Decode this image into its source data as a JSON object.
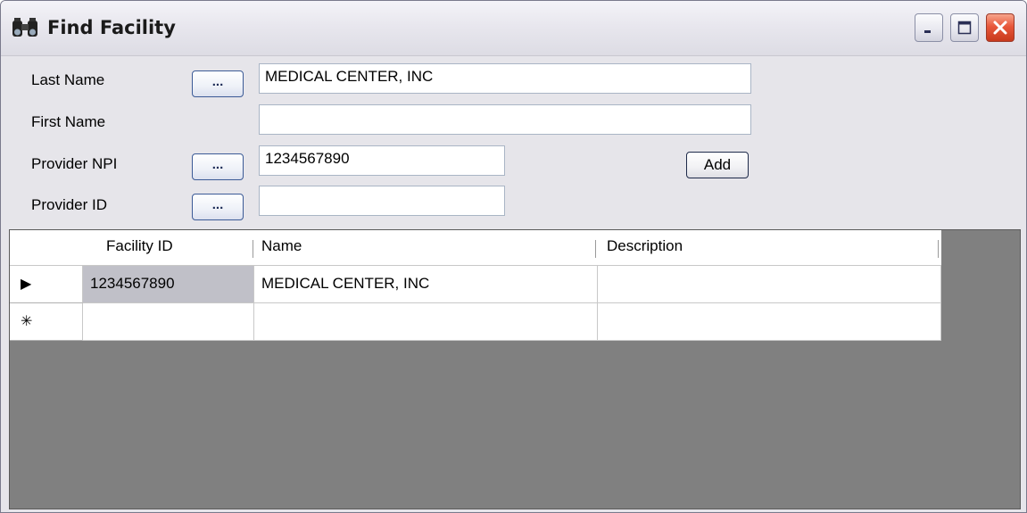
{
  "window": {
    "title": "Find Facility",
    "icon": "binoculars-icon",
    "controls": [
      "minimize-icon",
      "maximize-icon",
      "close-icon"
    ]
  },
  "form": {
    "last_name": {
      "label": "Last Name",
      "browse_label": "...",
      "value": "MEDICAL CENTER, INC"
    },
    "first_name": {
      "label": "First Name",
      "value": ""
    },
    "provider_npi": {
      "label": "Provider NPI",
      "browse_label": "...",
      "value": "1234567890"
    },
    "provider_id": {
      "label": "Provider ID",
      "browse_label": "...",
      "value": ""
    },
    "add_label": "Add"
  },
  "grid": {
    "columns": [
      "Facility ID",
      "Name",
      "Description"
    ],
    "rows": [
      {
        "indicator": "▶",
        "facility_id": "1234567890",
        "name": "MEDICAL CENTER, INC",
        "description": ""
      },
      {
        "indicator": "✳",
        "facility_id": "",
        "name": "",
        "description": ""
      }
    ]
  },
  "colors": {
    "grid_background": "#808080",
    "selected_cell": "#c0c0c8",
    "close_button": "#e8583b"
  }
}
